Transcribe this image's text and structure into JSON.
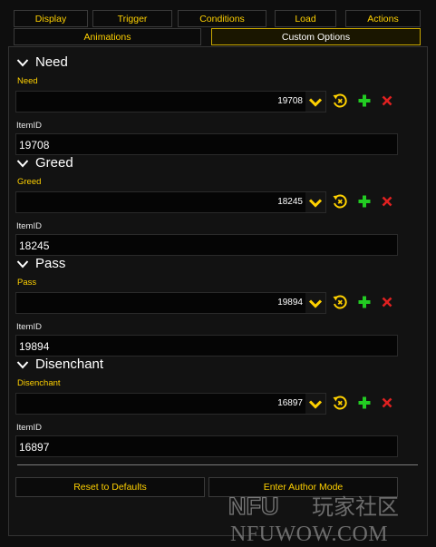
{
  "tabs": {
    "display": "Display",
    "trigger": "Trigger",
    "conditions": "Conditions",
    "load": "Load",
    "actions": "Actions",
    "animations": "Animations",
    "custom_options": "Custom Options"
  },
  "groups": [
    {
      "title": "Need",
      "label": "Need",
      "value": "19708",
      "itemid_label": "ItemID",
      "itemid_value": "19708"
    },
    {
      "title": "Greed",
      "label": "Greed",
      "value": "18245",
      "itemid_label": "ItemID",
      "itemid_value": "18245"
    },
    {
      "title": "Pass",
      "label": "Pass",
      "value": "19894",
      "itemid_label": "ItemID",
      "itemid_value": "19894"
    },
    {
      "title": "Disenchant",
      "label": "Disenchant",
      "value": "16897",
      "itemid_label": "ItemID",
      "itemid_value": "16897"
    }
  ],
  "footer": {
    "reset_label": "Reset to Defaults",
    "author_label": "Enter Author Mode"
  },
  "watermark": {
    "line1_latin": "NFU",
    "line1_cjk": "玩家社区",
    "line2": "NFUWOW.COM"
  },
  "colors": {
    "accent": "#ffd100",
    "add": "#22cc22",
    "delete": "#e02020"
  }
}
